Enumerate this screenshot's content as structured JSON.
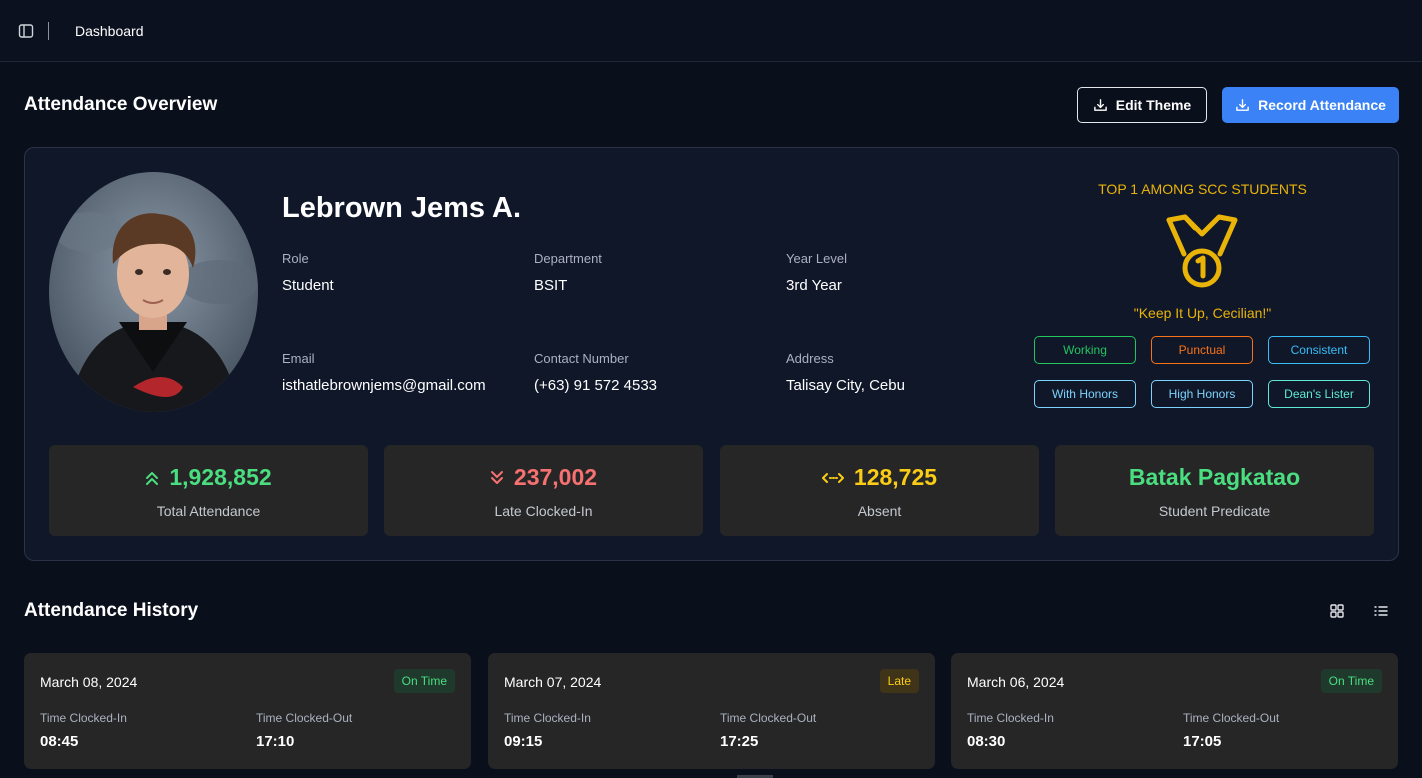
{
  "header": {
    "breadcrumb": "Dashboard"
  },
  "overview": {
    "title": "Attendance Overview",
    "edit_theme_label": "Edit Theme",
    "record_attendance_label": "Record Attendance"
  },
  "profile": {
    "name": "Lebrown Jems A.",
    "fields": [
      {
        "label": "Role",
        "value": "Student"
      },
      {
        "label": "Department",
        "value": "BSIT"
      },
      {
        "label": "Year Level",
        "value": "3rd Year"
      },
      {
        "label": "Email",
        "value": "isthatlebrownjems@gmail.com"
      },
      {
        "label": "Contact Number",
        "value": "(+63) 91 572 4533"
      },
      {
        "label": "Address",
        "value": "Talisay City, Cebu"
      }
    ],
    "rank_text": "TOP 1 AMONG SCC STUDENTS",
    "motto": "\"Keep It Up, Cecilian!\"",
    "badges": [
      {
        "label": "Working",
        "color": "#22c55e"
      },
      {
        "label": "Punctual",
        "color": "#f97316"
      },
      {
        "label": "Consistent",
        "color": "#38bdf8"
      },
      {
        "label": "With Honors",
        "color": "#7dd3fc"
      },
      {
        "label": "High Honors",
        "color": "#7dd3fc"
      },
      {
        "label": "Dean's Lister",
        "color": "#5eead4"
      }
    ]
  },
  "stats": [
    {
      "value": "1,928,852",
      "label": "Total Attendance",
      "color": "#4ade80",
      "icon": "chevrons-up-icon"
    },
    {
      "value": "237,002",
      "label": "Late Clocked-In",
      "color": "#f87171",
      "icon": "chevrons-down-icon"
    },
    {
      "value": "128,725",
      "label": "Absent",
      "color": "#facc15",
      "icon": "arrows-horizontal-icon"
    },
    {
      "value": "Batak Pagkatao",
      "label": "Student Predicate",
      "color": "#4ade80",
      "icon": ""
    }
  ],
  "history": {
    "title": "Attendance History",
    "clocked_in_label": "Time Clocked-In",
    "clocked_out_label": "Time Clocked-Out",
    "records": [
      {
        "date": "March 08, 2024",
        "status": "On Time",
        "in": "08:45",
        "out": "17:10"
      },
      {
        "date": "March 07, 2024",
        "status": "Late",
        "in": "09:15",
        "out": "17:25"
      },
      {
        "date": "March 06, 2024",
        "status": "On Time",
        "in": "08:30",
        "out": "17:05"
      }
    ]
  },
  "colors": {
    "accent": "#3b82f6",
    "gold": "#eab308",
    "on_time_text": "#4ade80",
    "on_time_bg": "#1f3a2c",
    "late_text": "#facc15",
    "late_bg": "#3f3417"
  }
}
